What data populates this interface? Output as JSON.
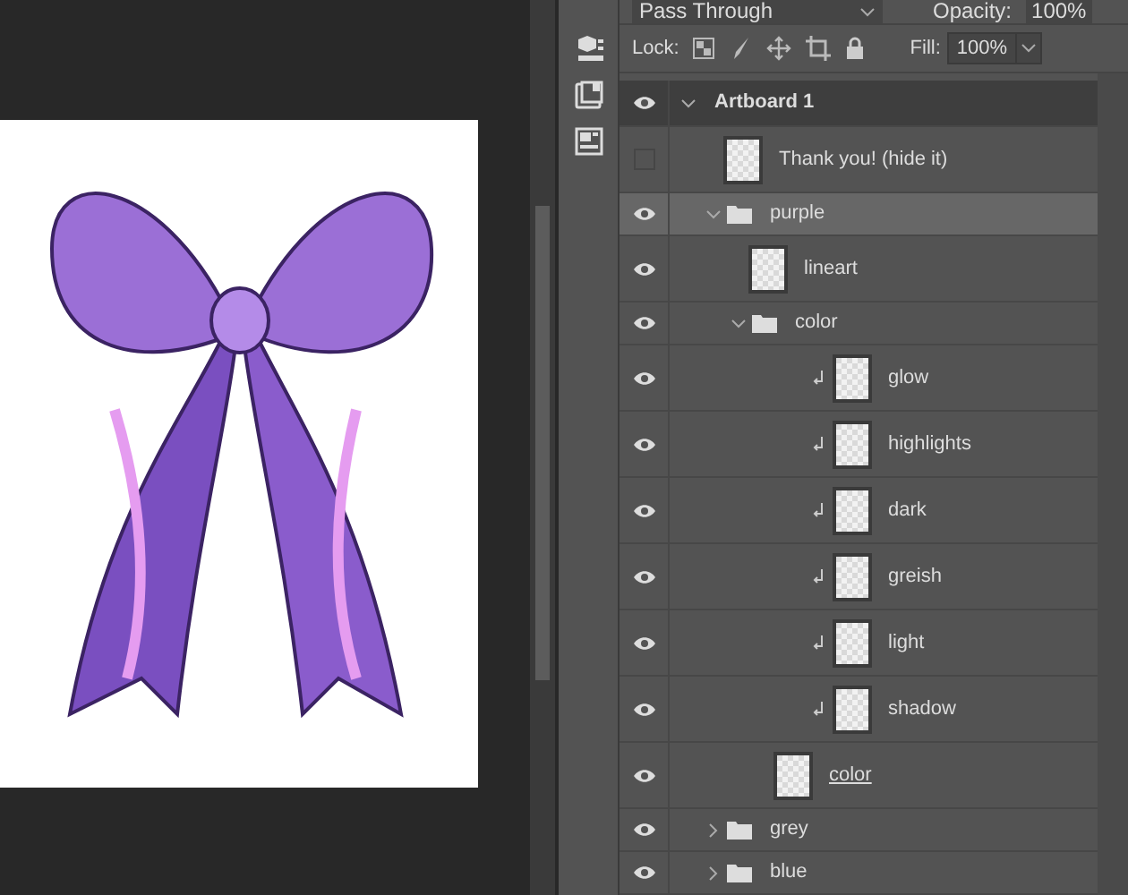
{
  "layer_options": {
    "blend_mode": "Pass Through",
    "opacity_label": "Opacity:",
    "opacity": "100%",
    "lock_label": "Lock:",
    "fill_label": "Fill:",
    "fill": "100%"
  },
  "layers": [
    {
      "kind": "artboard",
      "name": "Artboard 1",
      "visible": true,
      "selected": false,
      "expanded": true,
      "children": [
        {
          "kind": "layer",
          "name": "Thank you! (hide it)",
          "visible": false,
          "selected": false,
          "clipped": false,
          "clip_base": false
        },
        {
          "kind": "group",
          "name": "purple",
          "visible": true,
          "selected": true,
          "expanded": true,
          "children": [
            {
              "kind": "layer",
              "name": "lineart",
              "visible": true,
              "selected": false,
              "clipped": false,
              "clip_base": false
            },
            {
              "kind": "group",
              "name": "color",
              "visible": true,
              "selected": false,
              "expanded": true,
              "children": [
                {
                  "kind": "layer",
                  "name": "glow",
                  "visible": true,
                  "selected": false,
                  "clipped": true,
                  "clip_base": false
                },
                {
                  "kind": "layer",
                  "name": "highlights",
                  "visible": true,
                  "selected": false,
                  "clipped": true,
                  "clip_base": false
                },
                {
                  "kind": "layer",
                  "name": "dark",
                  "visible": true,
                  "selected": false,
                  "clipped": true,
                  "clip_base": false
                },
                {
                  "kind": "layer",
                  "name": "greish",
                  "visible": true,
                  "selected": false,
                  "clipped": true,
                  "clip_base": false
                },
                {
                  "kind": "layer",
                  "name": "light",
                  "visible": true,
                  "selected": false,
                  "clipped": true,
                  "clip_base": false
                },
                {
                  "kind": "layer",
                  "name": "shadow",
                  "visible": true,
                  "selected": false,
                  "clipped": true,
                  "clip_base": false
                },
                {
                  "kind": "layer",
                  "name": "color",
                  "visible": true,
                  "selected": false,
                  "clipped": false,
                  "clip_base": true
                }
              ]
            }
          ]
        },
        {
          "kind": "group",
          "name": "grey",
          "visible": true,
          "selected": false,
          "expanded": false
        },
        {
          "kind": "group",
          "name": "blue",
          "visible": true,
          "selected": false,
          "expanded": false
        }
      ]
    }
  ]
}
